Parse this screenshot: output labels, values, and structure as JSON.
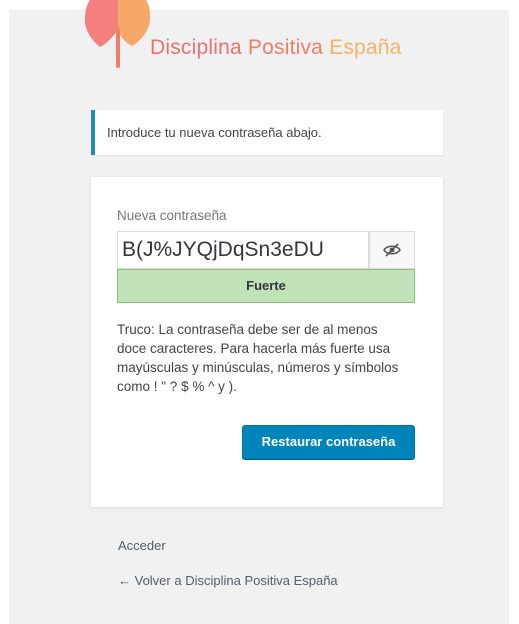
{
  "brand": {
    "name_word_1": "Disciplina",
    "name_word_2": "Positiva",
    "name_word_3": "España",
    "colors": {
      "heart_left": "#f37f7f",
      "heart_right": "#f6a866",
      "stem": "#f07f67"
    }
  },
  "message": {
    "text": "Introduce tu nueva contraseña abajo."
  },
  "form": {
    "password_label": "Nueva contraseña",
    "password_value": "B(J%JYQjDqSn3eDU",
    "toggle_icon": "eye-slash-icon",
    "strength_label": "Fuerte",
    "strength_color": "#c1e1b9",
    "hint": "Truco: La contraseña debe ser de al menos doce caracteres. Para hacerla más fuerte usa mayúsculas y minúsculas, números y símbolos como ! \" ? $ % ^ y ).",
    "submit_label": "Restaurar contraseña",
    "accent": "#0085ba"
  },
  "nav": {
    "login_label": "Acceder",
    "back_label": "← Volver a Disciplina Positiva España"
  }
}
